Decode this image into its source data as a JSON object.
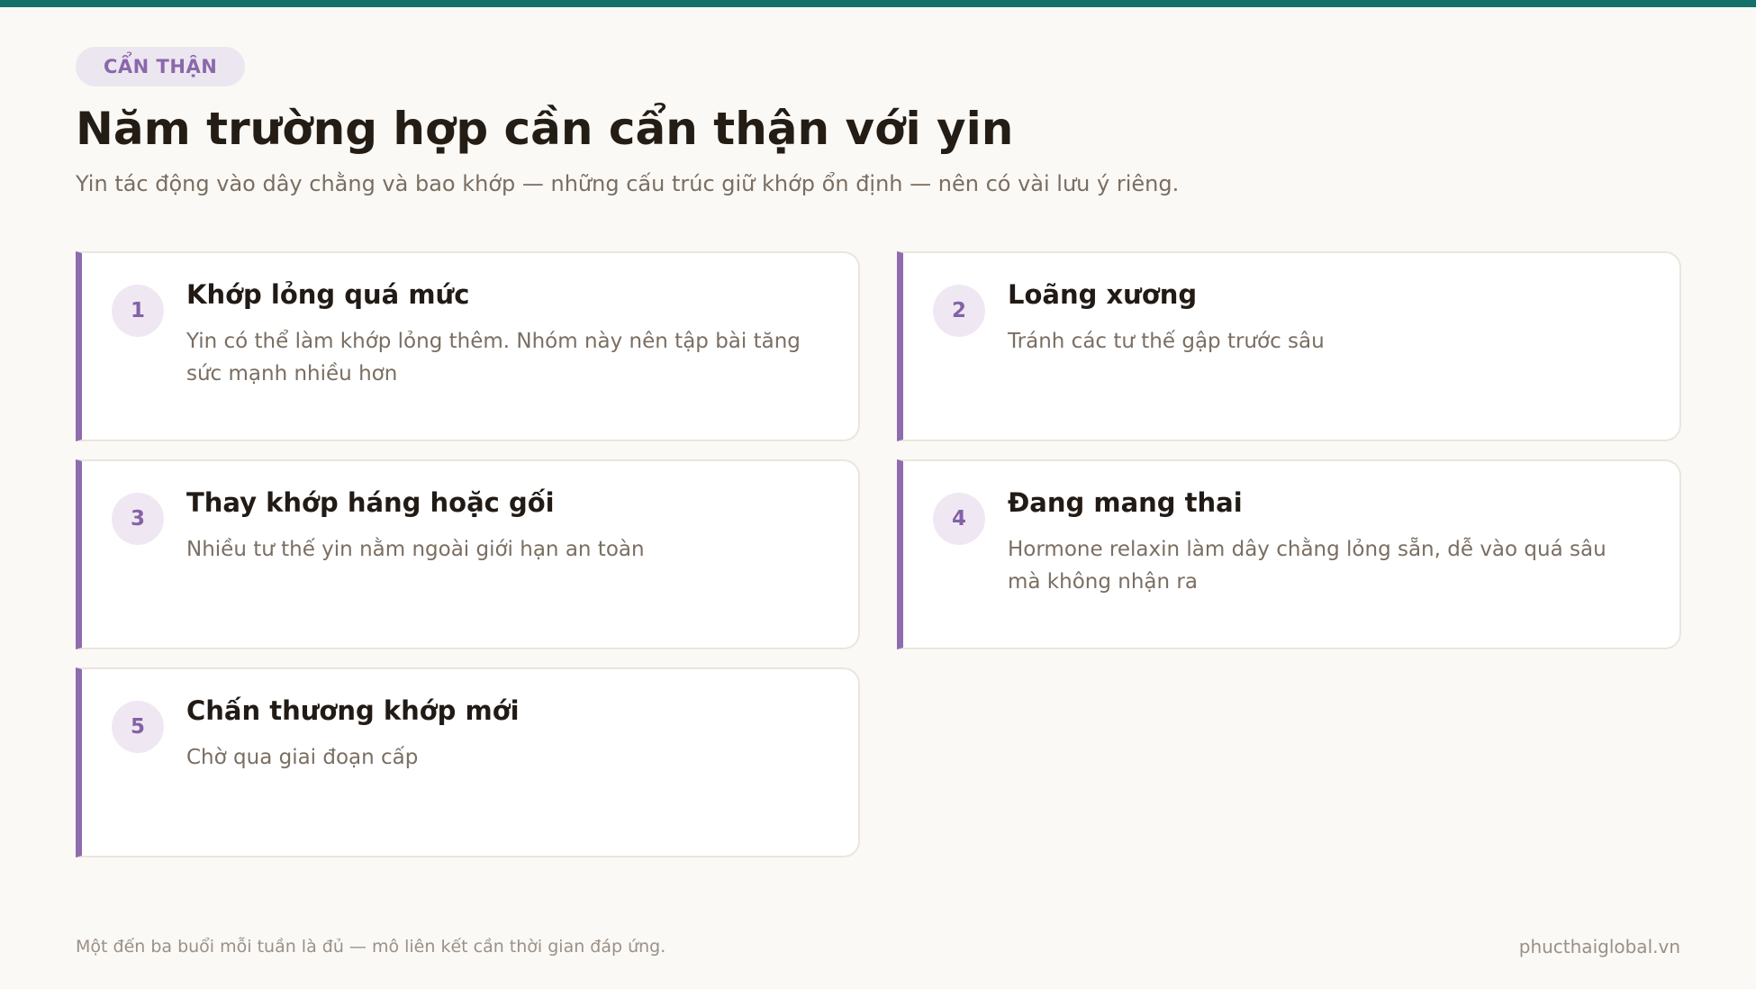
{
  "header": {
    "tag": "CẨN THẬN",
    "title": "Năm trường hợp cần cẩn thận với yin",
    "subtitle": "Yin tác động vào dây chằng và bao khớp — những cấu trúc giữ khớp ổn định — nên có vài lưu ý riêng."
  },
  "cards": [
    {
      "number": "1",
      "title": "Khớp lỏng quá mức",
      "desc": "Yin có thể làm khớp lỏng thêm. Nhóm này nên tập bài tăng sức mạnh nhiều hơn"
    },
    {
      "number": "2",
      "title": "Loãng xương",
      "desc": "Tránh các tư thế gập trước sâu"
    },
    {
      "number": "3",
      "title": "Thay khớp háng hoặc gối",
      "desc": "Nhiều tư thế yin nằm ngoài giới hạn an toàn"
    },
    {
      "number": "4",
      "title": "Đang mang thai",
      "desc": "Hormone relaxin làm dây chằng lỏng sẵn, dễ vào quá sâu mà không nhận ra"
    },
    {
      "number": "5",
      "title": "Chấn thương khớp mới",
      "desc": "Chờ qua giai đoạn cấp"
    }
  ],
  "footer": {
    "note": "Một đến ba buổi mỗi tuần là đủ — mô liên kết cần thời gian đáp ứng.",
    "site": "phucthaiglobal.vn"
  },
  "colors": {
    "accent": "#8e6cb0",
    "top_bar": "#147068",
    "background": "#fbf9f5"
  }
}
